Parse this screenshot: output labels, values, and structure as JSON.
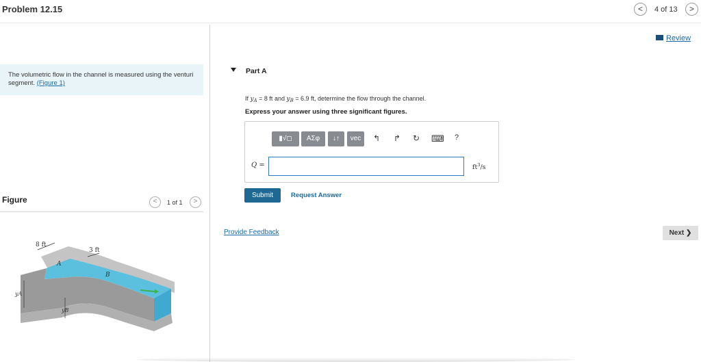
{
  "header": {
    "title": "Problem 12.15",
    "counter": "4 of 13",
    "prev_icon": "chevron-left-icon",
    "next_icon": "chevron-right-icon"
  },
  "review": {
    "label": "Review",
    "icon": "book-icon"
  },
  "intro": {
    "text": "The volumetric flow in the channel is measured using the venturi segment. ",
    "figure_link": "(Figure 1)"
  },
  "figure": {
    "title": "Figure",
    "counter": "1 of 1",
    "labels": {
      "width_a": "8 ft",
      "width_b": "3 ft",
      "point_a": "A",
      "point_b": "B",
      "depth_a": "yA",
      "depth_b": "yB"
    },
    "colors": {
      "water": "#5bc0de",
      "concrete": "#b8b8b8",
      "concrete_dark": "#8e8e8e"
    }
  },
  "part_a": {
    "label": "Part A",
    "question": {
      "prefix": "If ",
      "ya_var": "y",
      "ya_sub": "A",
      "ya_value": " = 8 ft",
      "middle": " and ",
      "yb_var": "y",
      "yb_sub": "B",
      "yb_value": " = 6.9 ft",
      "suffix": ", determine the flow through the channel."
    },
    "instruction": "Express your answer using three significant figures.",
    "toolbar": {
      "templates": "▮√◻",
      "greek": "ΑΣφ",
      "arrows": "↓↑",
      "vec": "vec",
      "undo": "↰",
      "redo": "↱",
      "reset": "↻",
      "keyboard": "⌨",
      "help": "?"
    },
    "answer": {
      "variable": "Q",
      "equals": " =",
      "value": "",
      "unit_base": "ft",
      "unit_exp": "3",
      "unit_tail": "/s"
    },
    "submit_label": "Submit",
    "request_label": "Request Answer"
  },
  "feedback_label": "Provide Feedback",
  "next_label": "Next ❯",
  "accent_colors": {
    "submit": "#1f6893",
    "link": "#1a6aa5",
    "intro_bg": "#e8f4f8"
  }
}
